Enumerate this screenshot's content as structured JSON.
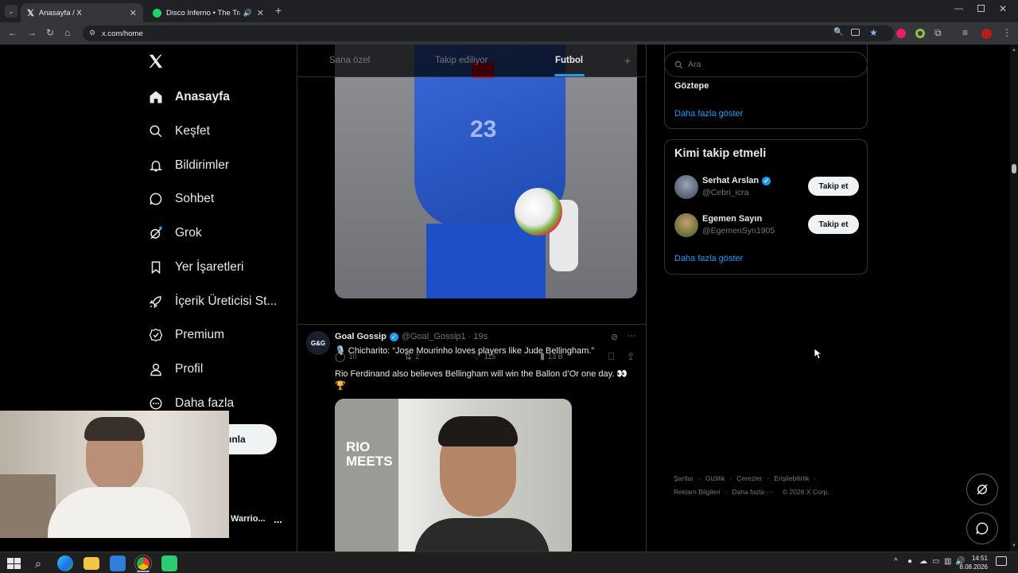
{
  "browser": {
    "tabs": [
      {
        "title": "Anasayfa / X"
      },
      {
        "title": "Disco Inferno • The Tramm"
      }
    ],
    "url": "x.com/home"
  },
  "sidebar": {
    "items": [
      {
        "label": "Anasayfa",
        "icon": "home-icon"
      },
      {
        "label": "Keşfet",
        "icon": "search-icon"
      },
      {
        "label": "Bildirimler",
        "icon": "bell-icon"
      },
      {
        "label": "Sohbet",
        "icon": "chat-icon"
      },
      {
        "label": "Grok",
        "icon": "grok-icon"
      },
      {
        "label": "Yer İşaretleri",
        "icon": "bookmark-icon"
      },
      {
        "label": "İçerik Üreticisi St...",
        "icon": "rocket-icon"
      },
      {
        "label": "Premium",
        "icon": "premium-icon"
      },
      {
        "label": "Profil",
        "icon": "person-icon"
      },
      {
        "label": "Daha fazla",
        "icon": "more-icon"
      }
    ],
    "post_button_partial": "ınla",
    "account_name_partial": "Warrio...",
    "account_more": "..."
  },
  "feed": {
    "tabs": [
      "Sana özel",
      "Takip ediliyor",
      "Futbol",
      "+"
    ],
    "post1_stats": {
      "replies": "10",
      "reposts": "2",
      "likes": "115",
      "views": "13 B"
    },
    "post2": {
      "author": "Goal Gossip",
      "handle": "@Goal_Gossip1",
      "time": "· 19s",
      "avatar_text": "G&G",
      "line1": "🎙️ Chicharito: “Jose Mourinho loves players like Jude Bellingham.”",
      "line2": "Rio Ferdinand also believes Bellingham will win the Ballon d’Or one day. 👀",
      "line3": "🏆",
      "media_overlay": "RIO\nMEETS"
    }
  },
  "right": {
    "search_placeholder": "Ara",
    "trend_item": "Göztepe",
    "trend_show_more": "Daha fazla göster",
    "who_to_follow": {
      "title": "Kimi takip etmeli",
      "users": [
        {
          "name": "Serhat Arslan",
          "handle": "@Cebri_icra",
          "button": "Takip et"
        },
        {
          "name": "Egemen Sayın",
          "handle": "@EgemenSyn1905",
          "button": "Takip et"
        }
      ],
      "show_more": "Daha fazla göster"
    },
    "footer": {
      "row1": [
        "Şartlar",
        "Gizlilik",
        "Çerezler",
        "Erişilebilirlik"
      ],
      "row2": [
        "Reklam Bilgileri",
        "Daha fazla ···",
        "© 2026 X Corp."
      ]
    }
  },
  "taskbar": {
    "time": "14:51",
    "date": "8.08.2026"
  },
  "colors": {
    "accent": "#1d9bf0",
    "border": "#2f3336",
    "muted": "#71767b"
  }
}
